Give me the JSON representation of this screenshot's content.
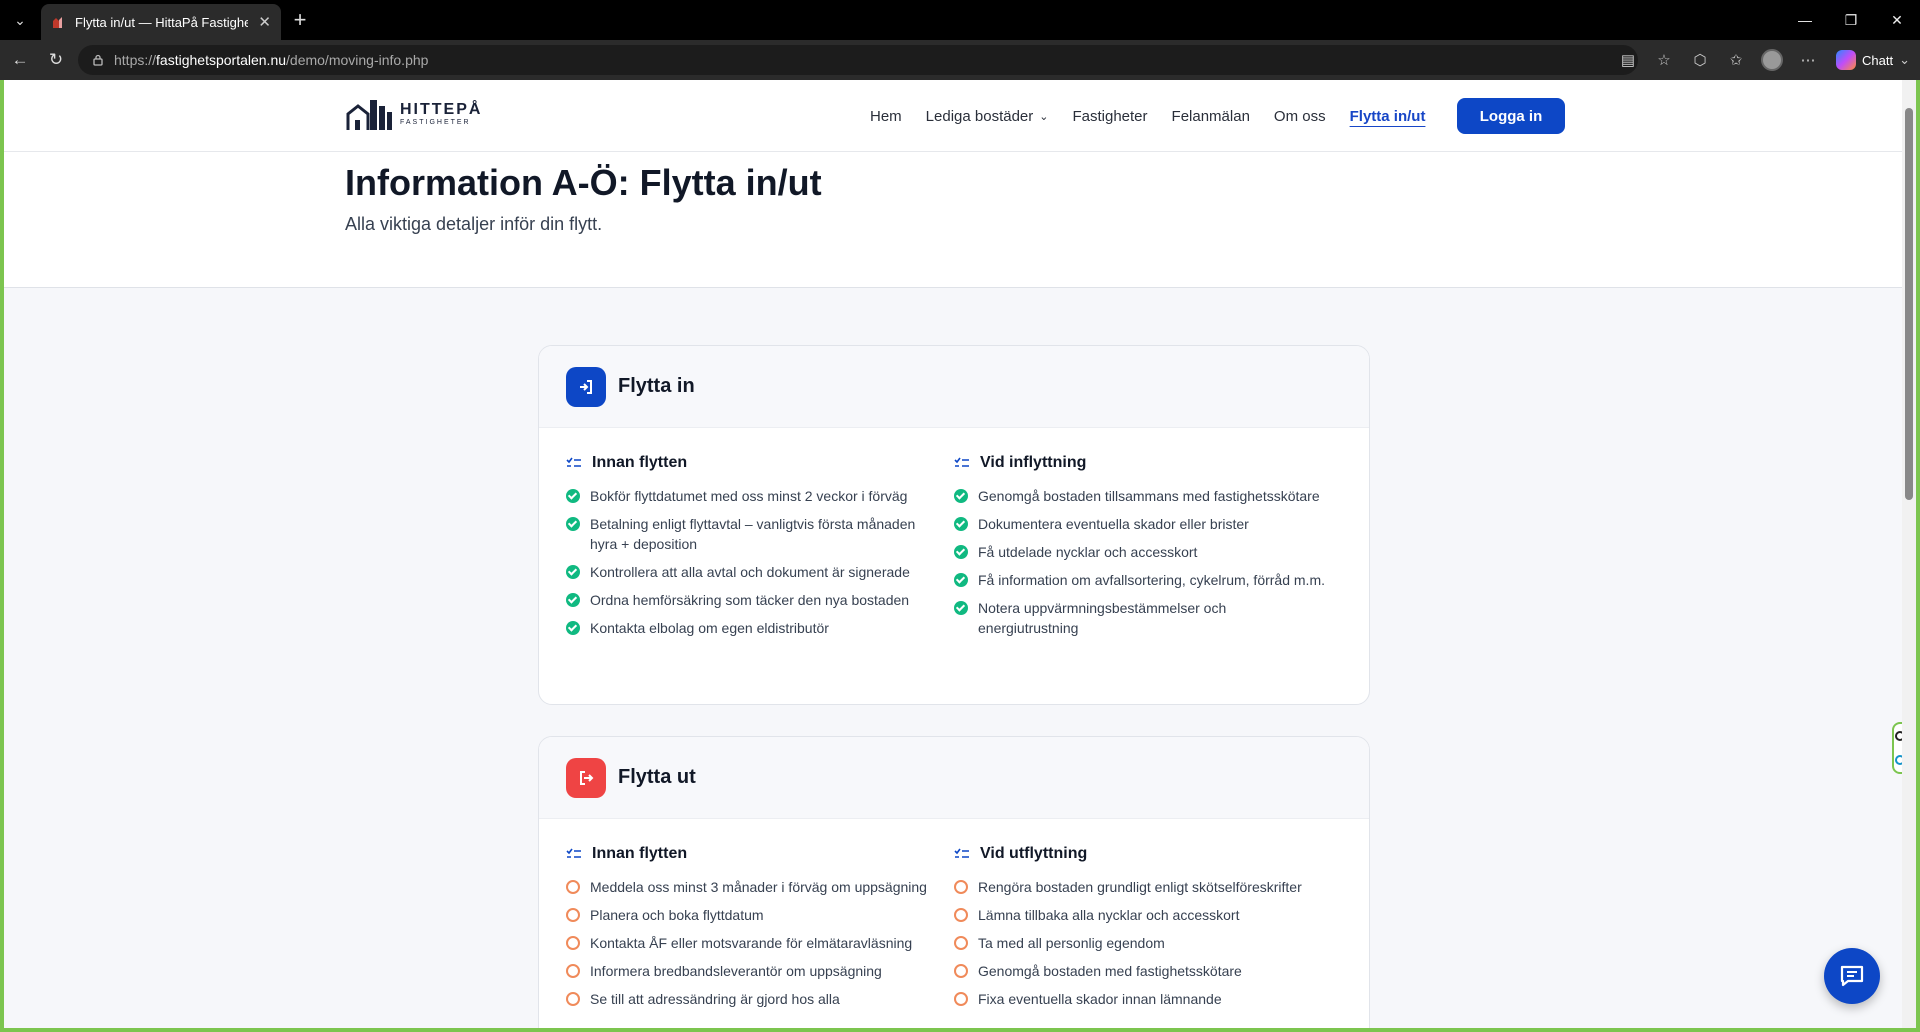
{
  "browser": {
    "tab_title": "Flytta in/ut — HittaPå Fastigheter",
    "url_scheme": "https://",
    "url_host": "fastighetsportalen.nu",
    "url_path": "/demo/moving-info.php",
    "copilot_label": "Chatt"
  },
  "site": {
    "logo_name": "HITTEPÅ",
    "logo_sub": "FASTIGHETER",
    "menu": [
      {
        "label": "Hem"
      },
      {
        "label": "Lediga bostäder"
      },
      {
        "label": "Fastigheter"
      },
      {
        "label": "Felanmälan"
      },
      {
        "label": "Om oss"
      },
      {
        "label": "Flytta in/ut"
      }
    ],
    "login_label": "Logga in"
  },
  "hero": {
    "title": "Information A-Ö: Flytta in/ut",
    "subtitle": "Alla viktiga detaljer inför din flytt."
  },
  "move_in": {
    "title": "Flytta in",
    "accent": "#0d47c6",
    "before": {
      "title": "Innan flytten",
      "items": [
        "Bokför flyttdatumet med oss minst 2 veckor i förväg",
        "Betalning enligt flyttavtal – vanligtvis första månaden hyra + deposition",
        "Kontrollera att alla avtal och dokument är signerade",
        "Ordna hemförsäkring som täcker den nya bostaden",
        "Kontakta elbolag om egen eldistributör"
      ]
    },
    "during": {
      "title": "Vid inflyttning",
      "items": [
        "Genomgå bostaden tillsammans med fastighetsskötare",
        "Dokumentera eventuella skador eller brister",
        "Få utdelade nycklar och accesskort",
        "Få information om avfallsortering, cykelrum, förråd m.m.",
        "Notera uppvärmningsbestämmelser och energiutrustning"
      ]
    }
  },
  "move_out": {
    "title": "Flytta ut",
    "accent": "#ef4444",
    "before": {
      "title": "Innan flytten",
      "items": [
        "Meddela oss minst 3 månader i förväg om uppsägning",
        "Planera och boka flyttdatum",
        "Kontakta ÅF eller motsvarande för elmätaravläsning",
        "Informera bredbandsleverantör om uppsägning",
        "Se till att adressändring är gjord hos alla"
      ]
    },
    "during": {
      "title": "Vid utflyttning",
      "items": [
        "Rengöra bostaden grundligt enligt skötselföreskrifter",
        "Lämna tillbaka alla nycklar och accesskort",
        "Ta med all personlig egendom",
        "Genomgå bostaden med fastighetsskötare",
        "Fixa eventuella skador innan lämnande"
      ]
    }
  }
}
